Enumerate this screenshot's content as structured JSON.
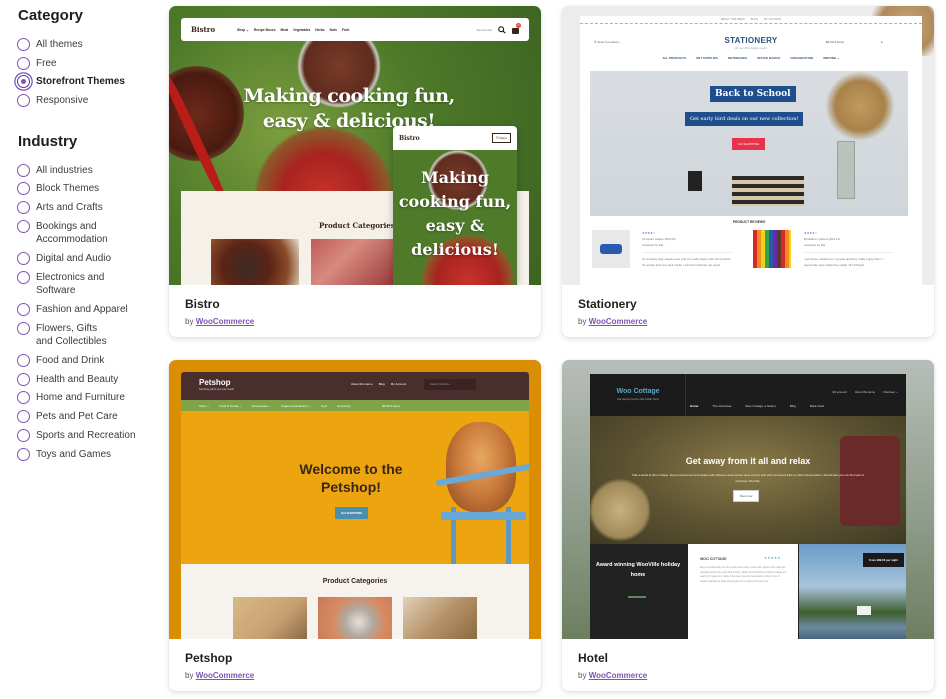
{
  "sidebar": {
    "category": {
      "title": "Category",
      "options": [
        {
          "label": "All themes",
          "checked": false
        },
        {
          "label": "Free",
          "checked": false
        },
        {
          "label": "Storefront Themes",
          "checked": true
        },
        {
          "label": "Responsive",
          "checked": false
        }
      ]
    },
    "industry": {
      "title": "Industry",
      "options": [
        {
          "label": "All industries",
          "checked": false
        },
        {
          "label": "Block Themes",
          "checked": false
        },
        {
          "label": "Arts and Crafts",
          "checked": false
        },
        {
          "label": "Bookings and Accommodation",
          "checked": false
        },
        {
          "label": "Digital and Audio",
          "checked": false
        },
        {
          "label": "Electronics and Software",
          "checked": false
        },
        {
          "label": "Fashion and Apparel",
          "checked": false
        },
        {
          "label": "Flowers, Gifts and Collectibles",
          "checked": false
        },
        {
          "label": "Food and Drink",
          "checked": false
        },
        {
          "label": "Health and Beauty",
          "checked": false
        },
        {
          "label": "Home and Furniture",
          "checked": false
        },
        {
          "label": "Pets and Pet Care",
          "checked": false
        },
        {
          "label": "Sports and Recreation",
          "checked": false
        },
        {
          "label": "Toys and Games",
          "checked": false
        }
      ]
    }
  },
  "themes": [
    {
      "name": "Bistro",
      "by": "by",
      "author": "WooCommerce",
      "preview": {
        "logo": "Bistro",
        "menu": [
          "Shop ⌄",
          "Recipe Boxes",
          "Meat",
          "Vegetables",
          "Herbs",
          "Nuts",
          "Fruit"
        ],
        "account": "My Account",
        "cart_count": "0",
        "hero": "Making cooking fun, easy & delicious!",
        "categories_title": "Product Categories",
        "mobile_logo": "Bistro",
        "mobile_menu": "☰ Menu",
        "mobile_hero": "Making cooking fun, easy & delicious!"
      }
    },
    {
      "name": "Stationery",
      "by": "by",
      "author": "WooCommerce",
      "preview": {
        "top_links": [
          "ABOUT THIS DEMO",
          "BLOG",
          "MY ACCOUNT"
        ],
        "search_placeholder": "Search products...",
        "logo": "STATIONERY",
        "tagline": "All your office supply needs!",
        "cart": "$0.00  0 items",
        "menu": [
          "ALL PRODUCTS",
          "ART SUPPLIES",
          "NOTEBOOKS",
          "OFFICE BASICS",
          "ORGANIZATION",
          "WRITING ⌄"
        ],
        "hero_title": "Back to School",
        "hero_sub": "Get early bird deals on our new collection!",
        "hero_button": "GO SHOPPING",
        "reviews_title": "PRODUCT REVIEWS",
        "reviews": [
          {
            "stars": "★★★★☆",
            "product": "Compact stapler ($10.00)",
            "reviewer": "reviewed by Ela",
            "text": "I'm a heavy duty stapler user and I'm really happy with this product. It's sturdy and very well made, I can tell it will last me years."
          },
          {
            "stars": "★★★★☆",
            "product": "Broadline markers ($14.11)",
            "reviewer": "reviewed by Ela",
            "text": "I got these markers for my kids and they really enjoy them. I appreciate how easily they wash off of things!"
          }
        ]
      }
    },
    {
      "name": "Petshop",
      "by": "by",
      "author": "WooCommerce",
      "preview": {
        "logo": "Petshop",
        "tagline": "Servicing all of your pet needs",
        "links": [
          "About this demo",
          "Blog",
          "My Account"
        ],
        "search_placeholder": "Search products...",
        "menu": [
          "Shop ⌄",
          "Food & Treats ⌄",
          "Accessories ⌄",
          "Cages & Aquariums ⌄",
          "Toys",
          "Grooming"
        ],
        "cart": "$0.00  0 items",
        "hero": "Welcome to the Petshop!",
        "hero_button": "GO SHOPPING",
        "categories_title": "Product Categories"
      }
    },
    {
      "name": "Hotel",
      "by": "by",
      "author": "WooCommerce",
      "preview": {
        "logo": "Woo Cottage",
        "tagline": "Self catering country-side holiday home",
        "links": [
          "My account",
          "About this demo",
          "Checkout ⌄"
        ],
        "menu": [
          "Home",
          "The local area",
          "Woo Cottage: a history",
          "Blog",
          "Book Now!"
        ],
        "hero_title": "Get away from it all and relax",
        "hero_sub": "Take a break at Woo Cottage. Enjoy luxurious accommodation with fabulous views across open country side with convenient links to public transportation, that will take you into the heart of downtown WooVille.",
        "hero_button": "Book now",
        "award": "Award winning WooVille holiday home",
        "desc_title": "WOO COTTAGE",
        "desc_stars": "★★★★★",
        "desc_body": "Enjoy a break away from the hustle and bustle in this quiet, idyllic home that was originally built in the early 20th century. While the foundations of Woo Cottage are nearly 100 years old, inside it has been recently renovated to offer a host of modern appliances while staying true to its original look and feel.",
        "price": "From £89.00 per night"
      }
    }
  ],
  "colors": {
    "accent": "#7f54b3",
    "bistro_green": "#4e7a2a",
    "stationery_blue": "#1f4e8c",
    "petshop_orange": "#eca50f",
    "hotel_teal": "#5aa8c8"
  }
}
